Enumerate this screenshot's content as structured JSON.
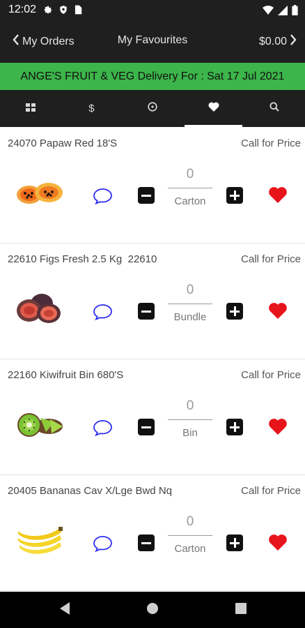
{
  "status_bar": {
    "time": "12:02",
    "left_icons": [
      "gear-icon",
      "shield-icon",
      "sim-card-icon"
    ],
    "right_icons": [
      "wifi-icon",
      "signal-icon",
      "battery-icon"
    ]
  },
  "top_nav": {
    "back_label": "My Orders",
    "title": "My Favourites",
    "total_label": "$0.00"
  },
  "banner": {
    "text": "ANGE'S FRUIT & VEG Delivery For : Sat 17 Jul 2021",
    "color": "#3cb54a"
  },
  "tabs": [
    {
      "icon": "grid-icon",
      "active": false
    },
    {
      "icon": "dollar-icon",
      "label": "$",
      "active": false
    },
    {
      "icon": "clock-icon",
      "active": false
    },
    {
      "icon": "heart-icon",
      "active": true
    },
    {
      "icon": "search-icon",
      "active": false
    }
  ],
  "products": [
    {
      "name": "24070 Papaw Red 18'S",
      "price": "Call for Price",
      "quantity": "0",
      "unit": "Carton",
      "image": "papaya-image",
      "favourite": true
    },
    {
      "name": "22610 Figs Fresh 2.5 Kg  22610",
      "price": "Call for Price",
      "quantity": "0",
      "unit": "Bundle",
      "image": "figs-image",
      "favourite": true
    },
    {
      "name": "22160 Kiwifruit Bin 680'S",
      "price": "Call for Price",
      "quantity": "0",
      "unit": "Bin",
      "image": "kiwifruit-image",
      "favourite": true
    },
    {
      "name": "20405 Bananas Cav X/Lge Bwd Nq",
      "price": "Call for Price",
      "quantity": "0",
      "unit": "Carton",
      "image": "bananas-image",
      "favourite": true
    }
  ],
  "colors": {
    "dark_bar": "#1f1f1f",
    "accent_green": "#3cb54a",
    "heart_red": "#e8141c",
    "comment_blue": "#2c2cf0"
  }
}
